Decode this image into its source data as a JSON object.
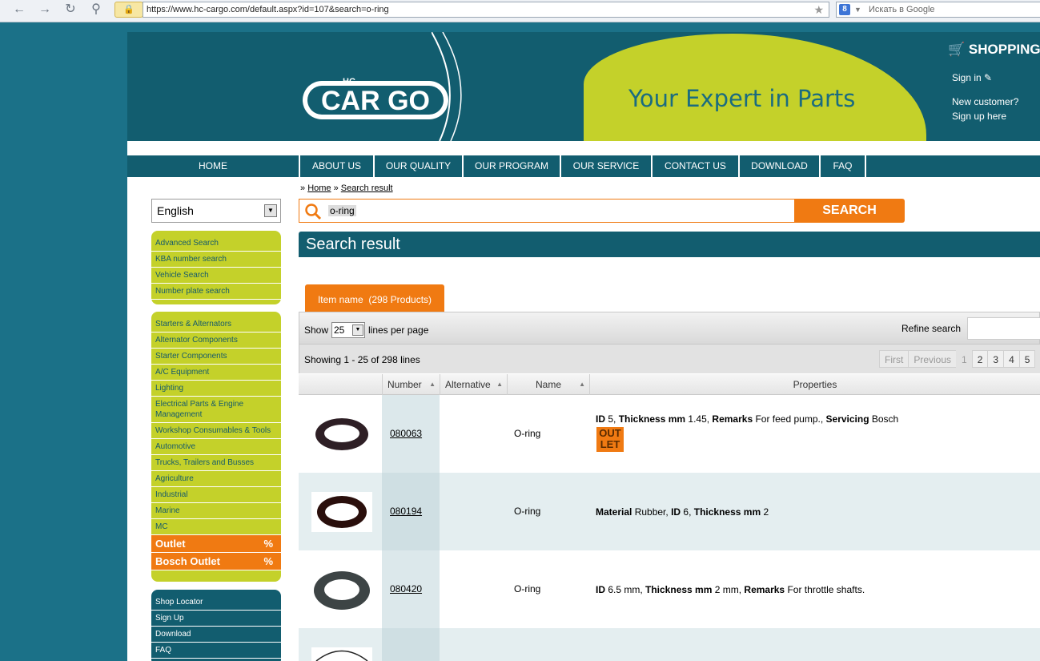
{
  "browser": {
    "url_prefix": "https://www.hc-cargo.com/default.aspx?id=107&search=o-ring",
    "search_engine_placeholder": "Искать в Google"
  },
  "header": {
    "logo_text": "CAR GO",
    "logo_small": "HC",
    "tagline": "Your Expert in Parts",
    "shopping_label": "SHOPPING",
    "sign_in": "Sign in",
    "new_customer": "New customer?",
    "sign_up_here": "Sign up here"
  },
  "nav": [
    {
      "label": "HOME"
    },
    {
      "label": "ABOUT US"
    },
    {
      "label": "OUR QUALITY"
    },
    {
      "label": "OUR PROGRAM"
    },
    {
      "label": "OUR SERVICE"
    },
    {
      "label": "CONTACT US"
    },
    {
      "label": "DOWNLOAD"
    },
    {
      "label": "FAQ"
    }
  ],
  "language": "English",
  "search_menu": [
    {
      "label": "Advanced Search"
    },
    {
      "label": "KBA number search"
    },
    {
      "label": "Vehicle Search"
    },
    {
      "label": "Number plate search"
    }
  ],
  "category_menu": [
    {
      "label": "Starters & Alternators"
    },
    {
      "label": "Alternator Components"
    },
    {
      "label": "Starter Components"
    },
    {
      "label": "A/C Equipment"
    },
    {
      "label": "Lighting"
    },
    {
      "label": "Electrical Parts & Engine Management"
    },
    {
      "label": "Workshop Consumables & Tools"
    },
    {
      "label": "Automotive"
    },
    {
      "label": "Trucks, Trailers and Busses"
    },
    {
      "label": "Agriculture"
    },
    {
      "label": "Industrial"
    },
    {
      "label": "Marine"
    },
    {
      "label": "MC"
    }
  ],
  "outlet_menu": [
    {
      "label": "Outlet",
      "suffix": "%"
    },
    {
      "label": "Bosch Outlet",
      "suffix": "%"
    }
  ],
  "bottom_menu": [
    {
      "label": "Shop Locator"
    },
    {
      "label": "Sign Up"
    },
    {
      "label": "Download"
    },
    {
      "label": "FAQ"
    }
  ],
  "breadcrumb": {
    "sep": "»",
    "home": "Home",
    "current": "Search result"
  },
  "search": {
    "value": "o-ring",
    "button": "SEARCH"
  },
  "result_title": "Search result",
  "tab_label": "Item name  (298 Products)",
  "toolbar": {
    "show_label": "Show",
    "show_value": "25",
    "lines_per_page": "lines per page",
    "refine_label": "Refine search",
    "showing": "Showing 1 - 25 of 298 lines",
    "pager": [
      "First",
      "Previous",
      "1",
      "2",
      "3",
      "4",
      "5"
    ]
  },
  "columns": [
    "Number",
    "Alternative",
    "Name",
    "Properties"
  ],
  "rows": [
    {
      "number": "080063",
      "name": "O-ring",
      "props": [
        {
          "k": "ID",
          "v": " 5, "
        },
        {
          "k": "Thickness mm",
          "v": " 1.45, "
        },
        {
          "k": "Remarks",
          "v": " For feed pump., "
        },
        {
          "k": "Servicing",
          "v": " Bosch"
        }
      ],
      "badge": "OUT LET"
    },
    {
      "number": "080194",
      "name": "O-ring",
      "props": [
        {
          "k": "Material",
          "v": " Rubber, "
        },
        {
          "k": "ID",
          "v": " 6, "
        },
        {
          "k": "Thickness mm",
          "v": " 2"
        }
      ]
    },
    {
      "number": "080420",
      "name": "O-ring",
      "props": [
        {
          "k": "ID",
          "v": " 6.5 mm, "
        },
        {
          "k": "Thickness mm",
          "v": " 2 mm, "
        },
        {
          "k": "Remarks",
          "v": " For throttle shafts."
        }
      ]
    }
  ],
  "colors": {
    "teal": "#125d6f",
    "lime": "#c4d12a",
    "orange": "#f07a12"
  }
}
